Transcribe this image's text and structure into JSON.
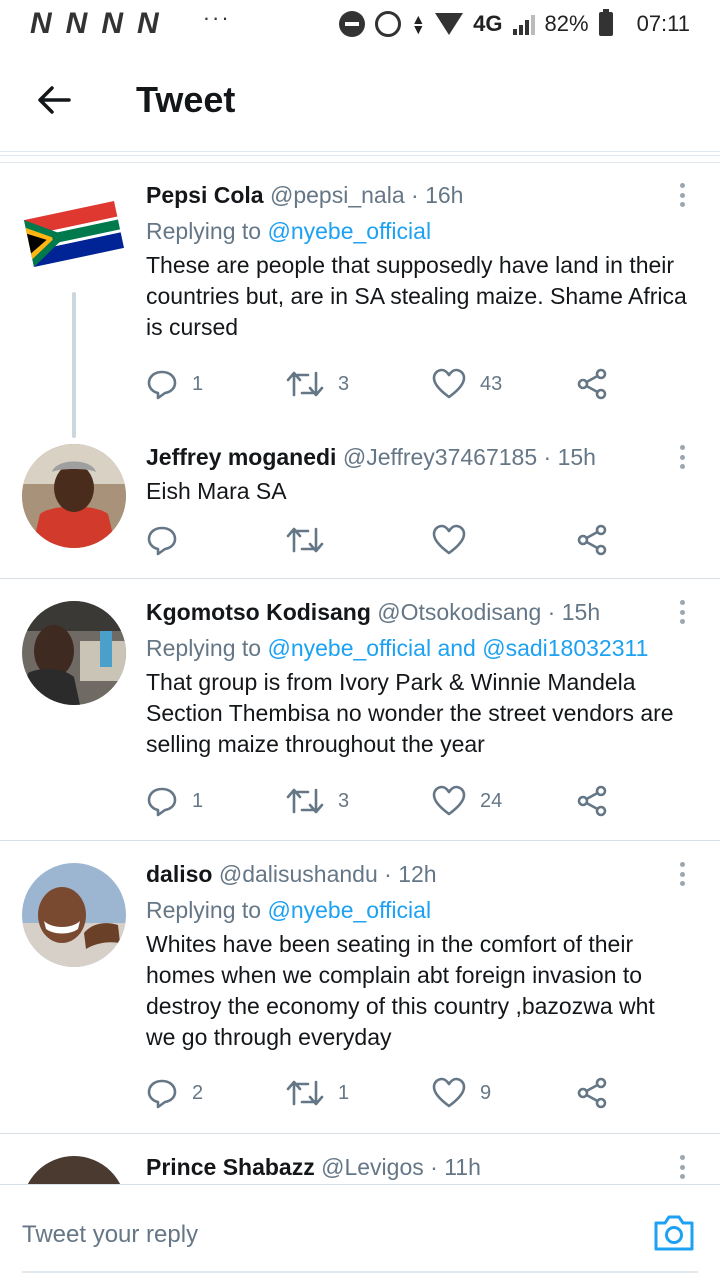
{
  "status_bar": {
    "notification_icons": [
      "N",
      "N",
      "N",
      "N"
    ],
    "overflow_dots": "···",
    "network": "4G",
    "battery": "82%",
    "time": "07:11"
  },
  "header": {
    "title": "Tweet",
    "back_icon": "arrow-left-icon"
  },
  "colors": {
    "accent": "#1da1f2",
    "secondary_text": "#657786",
    "primary_text": "#14171a"
  },
  "tweets": [
    {
      "name": "Pepsi Cola",
      "handle": "@pepsi_nala",
      "time": "16h",
      "replying_to": [
        "@nyebe_official"
      ],
      "text": "These are people that supposedly have land in their countries but, are in SA stealing maize. Shame Africa is cursed",
      "replies": "1",
      "retweets": "3",
      "likes": "43"
    },
    {
      "name": "Jeffrey moganedi",
      "handle": "@Jeffrey37467185",
      "time": "15h",
      "replying_to": [],
      "text": "Eish Mara SA",
      "replies": "",
      "retweets": "",
      "likes": ""
    },
    {
      "name": "Kgomotso Kodisang",
      "handle": "@Otsokodisang",
      "time": "15h",
      "replying_to": [
        "@nyebe_official",
        "@sadi18032311"
      ],
      "replying_joiner": "and",
      "text": "That group is from Ivory Park & Winnie Mandela Section Thembisa no wonder the street vendors are selling maize throughout the year",
      "replies": "1",
      "retweets": "3",
      "likes": "24"
    },
    {
      "name": "daliso",
      "handle": "@dalisushandu",
      "time": "12h",
      "replying_to": [
        "@nyebe_official"
      ],
      "text": "Whites have been seating in the comfort of their homes when we complain abt foreign invasion to destroy the economy of this country ,bazozwa wht we go through everyday",
      "replies": "2",
      "retweets": "1",
      "likes": "9"
    },
    {
      "name": "Prince Shabazz",
      "handle": "@Levigos",
      "time": "11h"
    }
  ],
  "labels": {
    "replying_prefix": "Replying to",
    "meta_separator": "·"
  },
  "reply_box": {
    "placeholder": "Tweet your reply",
    "camera_icon": "camera-icon"
  }
}
